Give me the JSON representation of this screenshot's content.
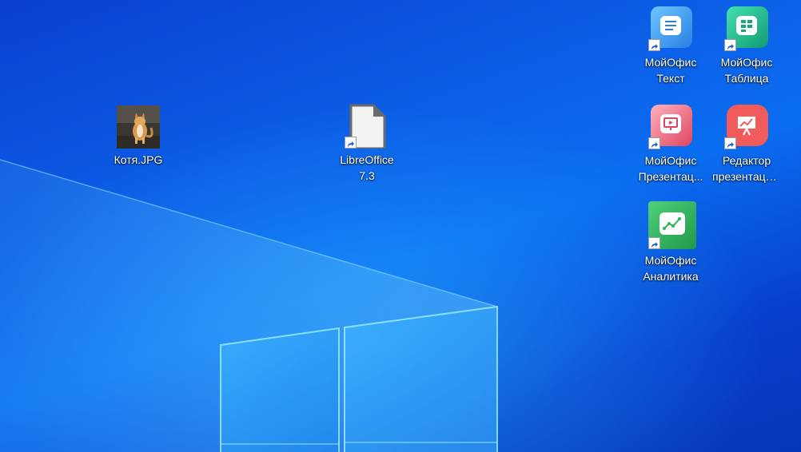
{
  "desktop": {
    "icons": [
      {
        "id": "kotya",
        "label": "Котя.JPG",
        "icon": "photo-thumbnail-icon"
      },
      {
        "id": "libreoffice",
        "label": "LibreOffice 7.3",
        "line1": "LibreOffice",
        "line2": "7.3",
        "icon": "libreoffice-document-icon"
      },
      {
        "id": "myoffice-text",
        "line1": "МойОфис",
        "line2": "Текст",
        "icon": "myoffice-text-icon",
        "color": "#2f8fe8"
      },
      {
        "id": "myoffice-table",
        "line1": "МойОфис",
        "line2": "Таблица",
        "icon": "myoffice-table-icon",
        "color": "#1bb38f"
      },
      {
        "id": "myoffice-presentation",
        "line1": "МойОфис",
        "line2": "Презентац...",
        "icon": "myoffice-presentation-icon",
        "color": "#e8536a"
      },
      {
        "id": "presentation-editor",
        "line1": "Редактор",
        "line2": "презентаци...",
        "icon": "presentation-editor-icon",
        "color": "#f05a5a"
      },
      {
        "id": "myoffice-analytics",
        "line1": "МойОфис",
        "line2": "Аналитика",
        "icon": "myoffice-analytics-icon",
        "color": "#2fb65a"
      }
    ]
  }
}
